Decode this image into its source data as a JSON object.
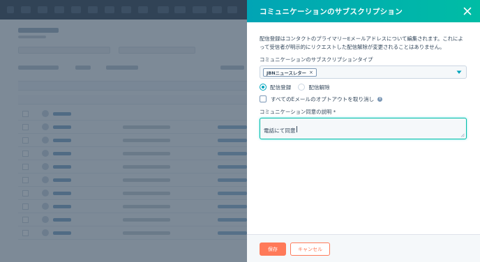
{
  "colors": {
    "header_start": "#01a4b5",
    "header_end": "#00bda5",
    "primary_button": "#ff7a59",
    "text": "#33475b",
    "radio_selected": "#00a4bd",
    "overlay": "#33475b"
  },
  "panel": {
    "title": "コミュニケーションのサブスクリプション",
    "close_icon": "close-icon",
    "description": "配信登録はコンタクトのプライマリーEメールアドレスについて編集されます。これによって受信者が明示的にリクエストした配信解除が変更されることはありません。",
    "subscription_type_label": "コミュニケーションのサブスクリプションタイプ",
    "subscription_tag": "JBNニュースレター",
    "radio_subscribe": "配信登録",
    "radio_unsubscribe": "配信解除",
    "radio_selected": "subscribe",
    "optout_label": "すべてのEメールのオプトアウトを取り消し",
    "optout_checked": false,
    "consent_label": "コミュニケーション同意の説明 *",
    "consent_value": "電話にて同意"
  },
  "footer": {
    "save_label": "保存",
    "cancel_label": "キャンセル"
  }
}
